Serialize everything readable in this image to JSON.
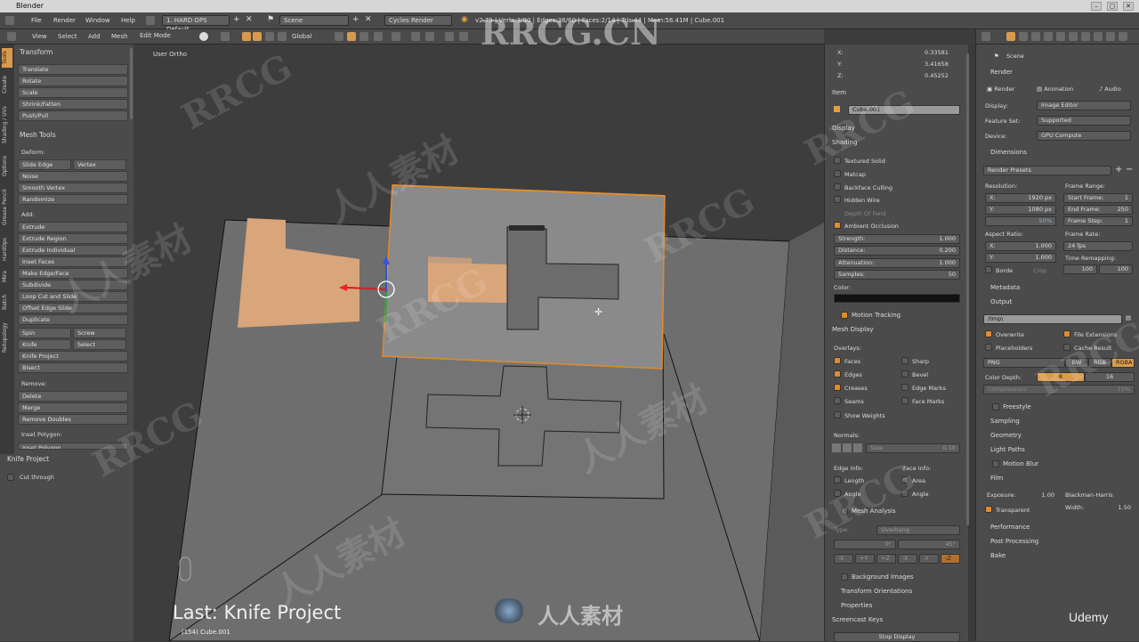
{
  "window": {
    "title": "Blender",
    "min": "–",
    "max": "▢",
    "close": "✕"
  },
  "menu": {
    "items": [
      "File",
      "Render",
      "Window",
      "Help"
    ],
    "layout": "1. HARD OPS Default",
    "scene": "Scene",
    "engine": "Cycles Render",
    "stats": "v2.79 | Verts:3/90 | Edges:36/60 | Faces:2/14 | Tris:44 | Mem:56.41M | Cube.001"
  },
  "header3d": {
    "view": "View",
    "select": "Select",
    "add": "Add",
    "mesh": "Mesh",
    "mode": "Edit Mode",
    "orientation": "Global"
  },
  "tabs": [
    "Tools",
    "Create",
    "Shading / UVs",
    "Options",
    "Grease Pencil",
    "HardOps",
    "Mira",
    "Batch",
    "Retopology"
  ],
  "toolshelf": {
    "transform_title": "Transform",
    "transform": [
      "Translate",
      "Rotate",
      "Scale",
      "Shrink/Fatten",
      "Push/Pull"
    ],
    "mesh_tools_title": "Mesh Tools",
    "deform_label": "Deform:",
    "slide_edge": "Slide Edge",
    "vertex": "Vertex",
    "deform": [
      "Noise",
      "Smooth Vertex",
      "Randomize"
    ],
    "add_label": "Add:",
    "add": [
      "Extrude",
      "Extrude Region",
      "Extrude Individual",
      "Inset Faces",
      "Make Edge/Face",
      "Subdivide",
      "Loop Cut and Slide",
      "Offset Edge Slide",
      "Duplicate"
    ],
    "spin": "Spin",
    "screw": "Screw",
    "knife": "Knife",
    "select": "Select",
    "knife_project": "Knife Project",
    "bisect": "Bisect",
    "remove_label": "Remove:",
    "remove": [
      "Delete",
      "Merge",
      "Remove Doubles"
    ],
    "inset_label": "Inset Polygon:",
    "inset_btn": "Inset Polygon"
  },
  "lastop": {
    "title": "Knife Project",
    "cut_through": "Cut through"
  },
  "viewport": {
    "view_name": "User Ortho",
    "last_op": "Last: Knife Project",
    "object_info": "(154) Cube.001"
  },
  "npanel": {
    "x_label": "X:",
    "x": "0.33581",
    "y_label": "Y:",
    "y": "3.41658",
    "z_label": "Z:",
    "z": "0.45252",
    "item_title": "Item",
    "item_name": "Cube.001",
    "display_title": "Display",
    "shading_title": "Shading",
    "shading": [
      "Textured Solid",
      "Matcap",
      "Backface Culling",
      "Hidden Wire",
      "Depth Of Field"
    ],
    "ao": "Ambient Occlusion",
    "strength_label": "Strength:",
    "strength": "1.000",
    "distance_label": "Distance:",
    "distance": "0.200",
    "attenuation_label": "Attenuation:",
    "attenuation": "1.000",
    "samples_label": "Samples:",
    "samples": "50",
    "color_label": "Color:",
    "motion_tracking": "Motion Tracking",
    "mesh_display": "Mesh Display",
    "overlays": "Overlays:",
    "ov_left": [
      "Faces",
      "Edges",
      "Creases",
      "Seams"
    ],
    "ov_right": [
      "Sharp",
      "Bevel",
      "Edge Marks",
      "Face Marks"
    ],
    "show_weights": "Show Weights",
    "normals": "Normals:",
    "size_label": "Size:",
    "size": "0.10",
    "edge_info": "Edge Info:",
    "face_info": "Face Info:",
    "length": "Length",
    "area": "Area",
    "angle1": "Angle",
    "angle2": "Angle",
    "mesh_analysis": "Mesh Analysis",
    "type_label": "Type:",
    "type": "Overhang",
    "deg0": "0°",
    "deg45": "45°",
    "axes": [
      "-X",
      "+Y",
      "+Z",
      "-X",
      "-Y",
      "-Z"
    ],
    "bg_images": "Background Images",
    "transform_orient": "Transform Orientations",
    "properties": "Properties",
    "screencast": "Screencast Keys",
    "stop_display": "Stop Display"
  },
  "props": {
    "scene": "Scene",
    "render_title": "Render",
    "render_btn": "Render",
    "animation_btn": "Animation",
    "audio_btn": "Audio",
    "display_label": "Display:",
    "display": "Image Editor",
    "feature_label": "Feature Set:",
    "feature": "Supported",
    "device_label": "Device:",
    "device": "GPU Compute",
    "dimensions": "Dimensions",
    "render_presets": "Render Presets",
    "resolution": "Resolution:",
    "res_x_label": "X:",
    "res_x": "1920 px",
    "res_y_label": "Y:",
    "res_y": "1080 px",
    "res_pct": "50%",
    "frame_range": "Frame Range:",
    "start_label": "Start Frame:",
    "start": "1",
    "end_label": "End Frame:",
    "end": "250",
    "step_label": "Frame Step:",
    "step": "1",
    "aspect": "Aspect Ratio:",
    "asp_x_label": "X:",
    "asp_x": "1.000",
    "asp_y_label": "Y:",
    "asp_y": "1.000",
    "frame_rate": "Frame Rate:",
    "fps": "24 fps",
    "time_remap": "Time Remapping:",
    "old": "100",
    "new": "100",
    "border": "Borde",
    "crop": "Crop",
    "metadata": "Metadata",
    "output": "Output",
    "output_path": "/tmp\\",
    "overwrite": "Overwrite",
    "file_ext": "File Extensions",
    "placeholders": "Placeholders",
    "cache": "Cache Result",
    "png": "PNG",
    "bw": "BW",
    "rgb": "RGB",
    "rgba": "RGBA",
    "color_depth": "Color Depth:",
    "depth8": "8",
    "depth16": "16",
    "compression": "Compression:",
    "comp_val": "15%",
    "freestyle": "Freestyle",
    "sampling": "Sampling",
    "geometry": "Geometry",
    "light_paths": "Light Paths",
    "motion_blur": "Motion Blur",
    "film": "Film",
    "exposure_label": "Exposure:",
    "exposure": "1.00",
    "filter": "Blackman-Harris",
    "transparent": "Transparent",
    "width_label": "Width:",
    "width": "1.50",
    "performance": "Performance",
    "post": "Post Processing",
    "bake": "Bake"
  },
  "watermarks": {
    "brand": "RRCG.CN",
    "cn": "人人素材",
    "rrcg": "RRCG",
    "udemy": "Udemy",
    "bottom": "人人素材"
  },
  "colors": {
    "accent": "#e08b2f",
    "selected_face": "#d9a57a",
    "panel": "#4b4b4b",
    "viewport": "#3d3d3d"
  }
}
